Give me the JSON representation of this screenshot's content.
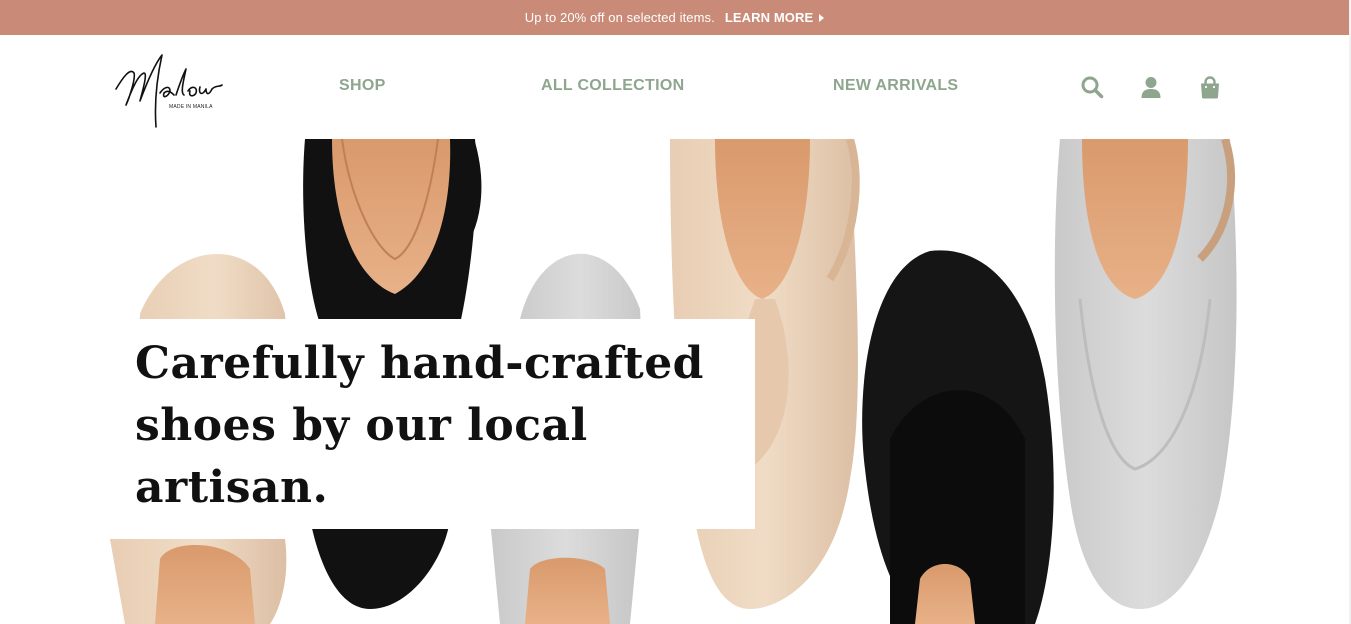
{
  "promo": {
    "text": "Up to 20% off on selected items.",
    "link_label": "LEARN MORE",
    "background": "#c98b77"
  },
  "brand": {
    "logo_script": "Malou",
    "logo_tagline": "MADE IN MANILA"
  },
  "nav": {
    "items": [
      {
        "label": "SHOP"
      },
      {
        "label": "ALL COLLECTION"
      },
      {
        "label": "NEW ARRIVALS"
      }
    ],
    "color": "#8ea58e"
  },
  "header_icons": [
    "search-icon",
    "user-icon",
    "shopping-bag-icon"
  ],
  "hero": {
    "headline": "Carefully hand-crafted shoes by our local artisan.",
    "image": "flat-shoes-photo"
  }
}
